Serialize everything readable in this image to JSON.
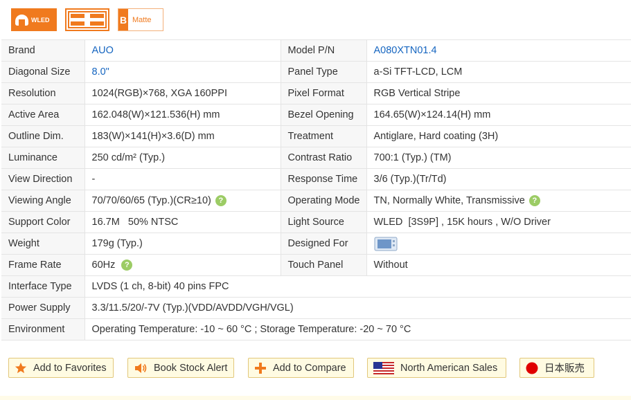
{
  "badges": {
    "wled": "WLED",
    "matte_letter": "B",
    "matte": "Matte"
  },
  "specs": {
    "brand_label": "Brand",
    "brand": "AUO",
    "model_label": "Model P/N",
    "model": "A080XTN01.4",
    "diag_label": "Diagonal Size",
    "diag": "8.0\"",
    "panel_label": "Panel Type",
    "panel": "a-Si TFT-LCD, LCM",
    "res_label": "Resolution",
    "res": "1024(RGB)×768, XGA  160PPI",
    "pixel_label": "Pixel Format",
    "pixel": "RGB Vertical Stripe",
    "active_label": "Active Area",
    "active": "162.048(W)×121.536(H) mm",
    "bezel_label": "Bezel Opening",
    "bezel": "164.65(W)×124.14(H) mm",
    "outline_label": "Outline Dim.",
    "outline": "183(W)×141(H)×3.6(D) mm",
    "treat_label": "Treatment",
    "treat": "Antiglare, Hard coating (3H)",
    "lum_label": "Luminance",
    "lum": "250 cd/m² (Typ.)",
    "contrast_label": "Contrast Ratio",
    "contrast": "700:1 (Typ.) (TM)",
    "viewdir_label": "View Direction",
    "viewdir": "-",
    "resp_label": "Response Time",
    "resp": "3/6 (Typ.)(Tr/Td)",
    "angle_label": "Viewing Angle",
    "angle": "70/70/60/65 (Typ.)(CR≥10)",
    "mode_label": "Operating Mode",
    "mode": "TN, Normally White, Transmissive",
    "color_label": "Support Color",
    "color": "16.7M   50% NTSC",
    "light_label": "Light Source",
    "light": "WLED  [3S9P] , 15K hours , W/O Driver",
    "weight_label": "Weight",
    "weight": "179g (Typ.)",
    "designed_label": "Designed For",
    "frame_label": "Frame Rate",
    "frame": "60Hz",
    "touch_label": "Touch Panel",
    "touch": "Without",
    "iface_label": "Interface Type",
    "iface": "LVDS (1 ch, 8-bit) 40 pins FPC",
    "power_label": "Power Supply",
    "power": "3.3/11.5/20/-7V (Typ.)(VDD/AVDD/VGH/VGL)",
    "env_label": "Environment",
    "env": "Operating Temperature: -10 ~ 60 °C ; Storage Temperature: -20 ~ 70 °C",
    "help_glyph": "?"
  },
  "actions": {
    "favorites": "Add to Favorites",
    "stock_alert": "Book Stock Alert",
    "compare": "Add to Compare",
    "na_sales": "North American Sales",
    "japan_sales": "日本販売"
  },
  "colors": {
    "accent": "#f07a1e",
    "link": "#1565c0",
    "help": "#9ccc65",
    "button_bg": "#fffbe2"
  }
}
